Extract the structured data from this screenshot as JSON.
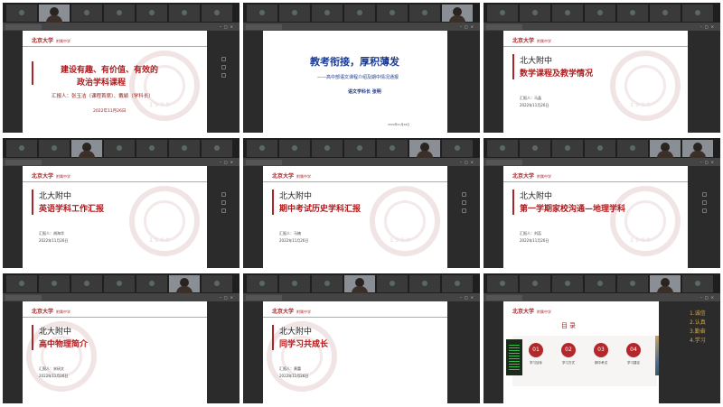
{
  "panels": [
    {
      "faces": [
        1
      ],
      "logo": "北京大学",
      "logo_sub": "附属中学",
      "title_lines": [
        "建设有趣、有价值、有效的",
        "政治学科课程"
      ],
      "reporter": "汇报人：张玉洁（课程首席）、戴颖（学科长）",
      "date": "2022年11月26日"
    },
    {
      "faces": [
        9
      ],
      "title": "教考衔接，厚积薄发",
      "subtitle": "——高中部语文课程介绍及期中情况通报",
      "author": "语文学科长  张明",
      "date": "2022年11月26日"
    },
    {
      "faces": [],
      "logo": "北京大学",
      "logo_sub": "附属中学",
      "school": "北大附中",
      "subject": "数学课程及教学情况",
      "reporter": "汇报人：马晶",
      "date": "2022年11月26日"
    },
    {
      "faces": [
        2
      ],
      "logo": "北京大学",
      "logo_sub": "附属中学",
      "school": "北大附中",
      "subject": "英语学科工作汇报",
      "reporter": "汇报人：胡海华",
      "date": "2022年11月26日"
    },
    {
      "faces": [
        9
      ],
      "logo": "北京大学",
      "logo_sub": "附属中学",
      "school": "北大附中",
      "subject": "期中考试历史学科汇报",
      "reporter": "汇报人：马楠",
      "date": "2022年11月26日"
    },
    {
      "faces": [
        9,
        10
      ],
      "logo": "北京大学",
      "logo_sub": "附属中学",
      "school": "北大附中",
      "subject": "第一学期家校沟通—地理学科",
      "reporter": "汇报人：刘蕊",
      "date": "2022年11月26日"
    },
    {
      "faces": [
        6
      ],
      "logo": "北京大学",
      "logo_sub": "附属中学",
      "school": "北大附中",
      "subject": "高中物理简介",
      "reporter": "汇报人：宋研文",
      "date": "2022年11月26日"
    },
    {
      "faces": [
        4
      ],
      "logo": "北京大学",
      "logo_sub": "附属中学",
      "school": "北大附中",
      "subject": "同学习共成长",
      "reporter": "汇报人：黄蕾",
      "date": "2022年11月26日"
    },
    {
      "faces": [
        7
      ],
      "logo": "北京大学",
      "logo_sub": "附属中学",
      "toc_title": "目录",
      "toc": [
        {
          "num": "01",
          "label": "学习目标"
        },
        {
          "num": "02",
          "label": "学习方式"
        },
        {
          "num": "03",
          "label": "期中考试"
        },
        {
          "num": "04",
          "label": "学习建议"
        }
      ],
      "list": [
        "1.诚信",
        "2.认真",
        "3.勤奋",
        "4.学习"
      ]
    }
  ],
  "seal_year": "1960",
  "colors": {
    "accent_red": "#a7262a",
    "title_red": "#b0191b",
    "blue": "#1b3b8f",
    "gold": "#d3a64a"
  }
}
